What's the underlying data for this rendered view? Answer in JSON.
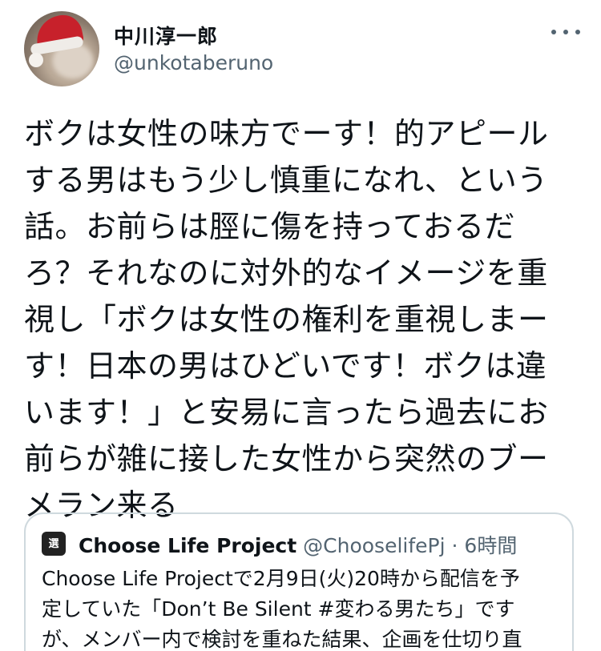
{
  "author": {
    "display_name": "中川淳一郎",
    "handle": "@unkotaberuno"
  },
  "tweet": {
    "text": "ボクは女性の味方でーす！的アピール\nする男はもう少し慎重になれ、という\n話。お前らは脛に傷を持っておるだ\nろ？それなのに対外的なイメージを重\n視し「ボクは女性の権利を重視しまー\nす！日本の男はひどいです！ボクは違\nいます！」と安易に言ったら過去にお\n前らが雑に接した女性から突然のブー\nメラン来る"
  },
  "quoted_tweet": {
    "avatar_text": "選",
    "name": "Choose Life Project",
    "handle": "@ChooselifePj",
    "separator": "·",
    "time": "6時間",
    "text": "Choose Life Projectで2月9日(火)20時から配信を予\n定していた「Don’t Be Silent #変わる男たち」です\nが、メンバー内で検討を重ねた結果、企画を仕切り直"
  },
  "icons": {
    "more": "more-horizontal-icon"
  },
  "colors": {
    "text_primary": "#0f1419",
    "text_secondary": "#536471",
    "border": "#cfd9de",
    "background": "#ffffff"
  }
}
